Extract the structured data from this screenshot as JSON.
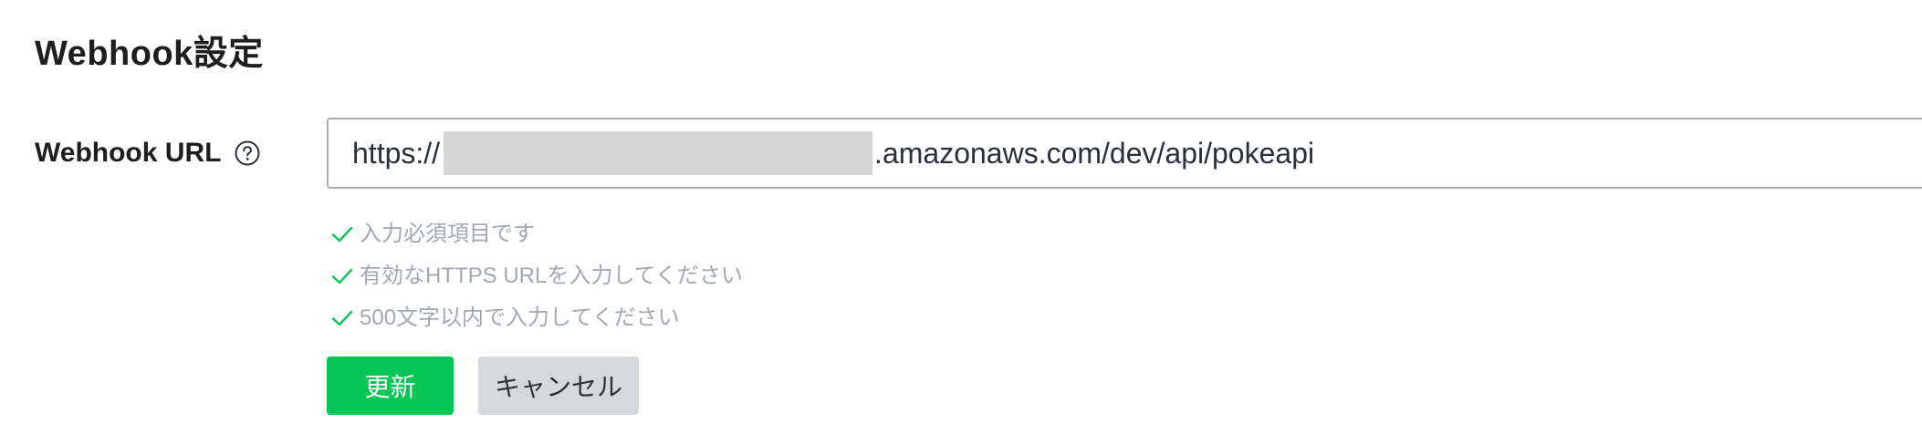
{
  "section": {
    "title": "Webhook設定"
  },
  "webhook_field": {
    "label": "Webhook URL",
    "help_icon": "question-circle-icon",
    "value_prefix": "https://",
    "value_suffix": ".amazonaws.com/dev/api/pokeapi"
  },
  "validations": [
    {
      "icon": "check-icon",
      "text": "入力必須項目です"
    },
    {
      "icon": "check-icon",
      "text": "有効なHTTPS URLを入力してください"
    },
    {
      "icon": "check-icon",
      "text": "500文字以内で入力してください"
    }
  ],
  "actions": {
    "update_label": "更新",
    "cancel_label": "キャンセル"
  },
  "colors": {
    "primary_green": "#06c755",
    "check_green": "#06c755",
    "cancel_bg": "#d5d9de",
    "hint_text": "#a3a8b1"
  }
}
